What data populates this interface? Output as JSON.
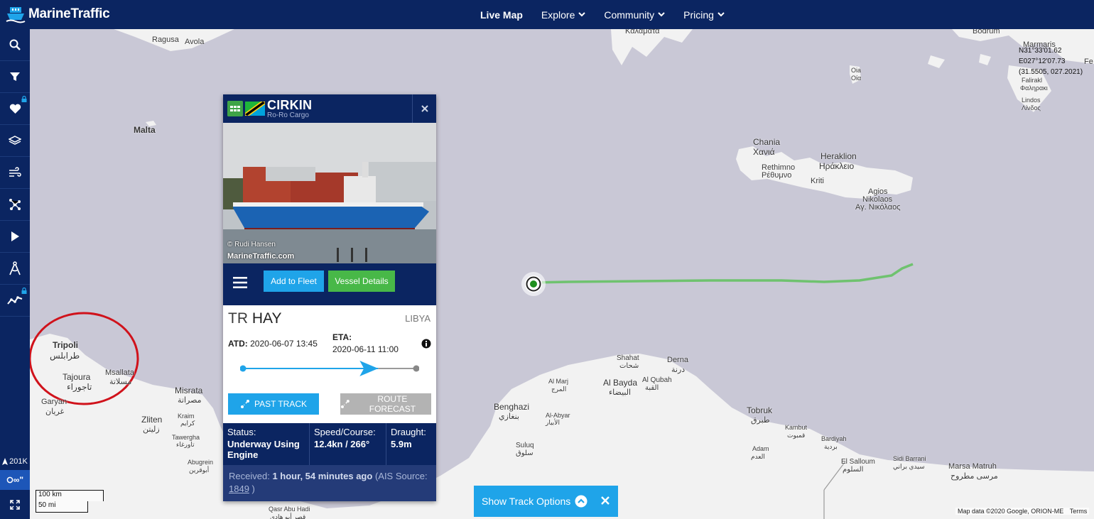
{
  "brand": {
    "name": "MarineTraffic"
  },
  "nav": [
    {
      "label": "Live Map"
    },
    {
      "label": "Explore"
    },
    {
      "label": "Community"
    },
    {
      "label": "Pricing"
    }
  ],
  "sidebar": {
    "items": [
      "search-icon",
      "filter-icon",
      "heart-icon",
      "layers-icon",
      "wind-icon",
      "network-icon",
      "play-icon",
      "compass-icon",
      "chart-icon"
    ],
    "vessel_count": "201K",
    "timer": "∞\""
  },
  "map": {
    "labels": {
      "ragusa": "Ragusa",
      "avola": "Avola",
      "malta": "Malta",
      "kalamata": "Καλαματα",
      "bodrum": "Bodrum",
      "marmaris": "Marmaris",
      "fe": "Fe",
      "oia": "Oia",
      "oia_gr": "Οία",
      "falirakl": "Falirakl",
      "faliraki_gr": "Φαληρακι",
      "lindos": "Lindos",
      "lindos_gr": "Λίνδος",
      "chania": "Chania",
      "chania_gr": "Χανιά",
      "heraklion": "Heraklion",
      "heraklion_gr": "Ηράκλειο",
      "rethimno": "Rethimno",
      "rethimno_gr": "Ρέθυμνο",
      "kriti": "Kriti",
      "agios": "Agios",
      "nikolaos": "Nikolaos",
      "agios_gr": "Αγ. Νικόλαος",
      "tripoli": "Tripoli",
      "tripoli_ar": "طرابلس",
      "tajoura": "Tajoura",
      "tajoura_ar": "تاجوراء",
      "msallata": "Msallata",
      "msallata_ar": "مسلاتة",
      "garyan": "Garyan",
      "garyan_ar": "غريان",
      "misrata": "Misrata",
      "misrata_ar": "مصراتة",
      "zliten": "Zliten",
      "zliten_ar": "زليتن",
      "kraim": "Kraim",
      "kraim_ar": "كرايم",
      "tawergha": "Tawergha",
      "tawergha_ar": "تاورغاء",
      "abugrein": "Abugrein",
      "abugrein_ar": "أبوقرين",
      "shahat": "Shahat",
      "shahat_ar": "شحات",
      "derna": "Derna",
      "derna_ar": "درنة",
      "almarj": "Al Marj",
      "almarj_ar": "المرج",
      "albayda": "Al Bayda",
      "albayda_ar": "البيضاء",
      "alqubah": "Al Qubah",
      "alqubah_ar": "القبة",
      "benghazi": "Benghazi",
      "benghazi_ar": "بنغازي",
      "alabyar": "Al-Abyar",
      "alabyar_ar": "الأبيار",
      "suluq": "Suluq",
      "suluq_ar": "سلوق",
      "tobruk": "Tobruk",
      "tobruk_ar": "طبرق",
      "kambut": "Kambut",
      "kambut_ar": "قمبوت",
      "bardiyah": "Bardiyah",
      "bardiyah_ar": "بردية",
      "adam": "Adam",
      "adam_ar": "العدم",
      "elsalloum": "El Salloum",
      "elsalloum_ar": "السلوم",
      "sidibarrani": "Sidi Barrani",
      "sidibarrani_ar": "سيدي براني",
      "marsamatruh": "Marsa Matruh",
      "marsamatruh_ar": "مرسى مطروح",
      "qasr": "Qasr Abu Hadi",
      "qasr_ar": "قصر أبو هادي"
    },
    "coords": {
      "lat": "N31°33'01.62",
      "lon": "E027°12'07.73",
      "decimal": "(31.5505, 027.2021)"
    },
    "scale": {
      "km": "100 km",
      "mi": "50 mi"
    },
    "attribution": "Map data ©2020 Google, ORION-ME",
    "terms": "Terms"
  },
  "vessel": {
    "name": "CIRKIN",
    "type": "Ro-Ro Cargo",
    "photo_credit": "© Rudi Hansen",
    "photo_site": "MarineTraffic.com",
    "add_fleet": "Add to Fleet",
    "details": "Vessel Details",
    "dest_prefix": "TR",
    "dest_port": "HAY",
    "dest_country": "LIBYA",
    "atd_label": "ATD:",
    "atd_value": "2020-06-07 13:45",
    "eta_label": "ETA:",
    "eta_value": "2020-06-11 11:00",
    "progress": 0.78,
    "past_track": "PAST TRACK",
    "route_forecast": "ROUTE FORECAST",
    "status_label": "Status:",
    "status_value": "Underway Using Engine",
    "speed_label": "Speed/Course:",
    "speed_value": "12.4kn / 266°",
    "draught_label": "Draught:",
    "draught_value": "5.9m",
    "received_label": "Received:",
    "received_value": "1 hour, 54 minutes ago",
    "received_source_prefix": "(AIS Source:",
    "received_source": "1849",
    "received_suffix": ")"
  },
  "track_options": {
    "label": "Show Track Options"
  },
  "colors": {
    "navy": "#0b2561",
    "blue": "#1fa4e9",
    "green": "#48b848",
    "sea": "#c9c8d6",
    "land": "#f2f2f2",
    "track": "#6fc26f",
    "annotation": "#d0121b"
  }
}
